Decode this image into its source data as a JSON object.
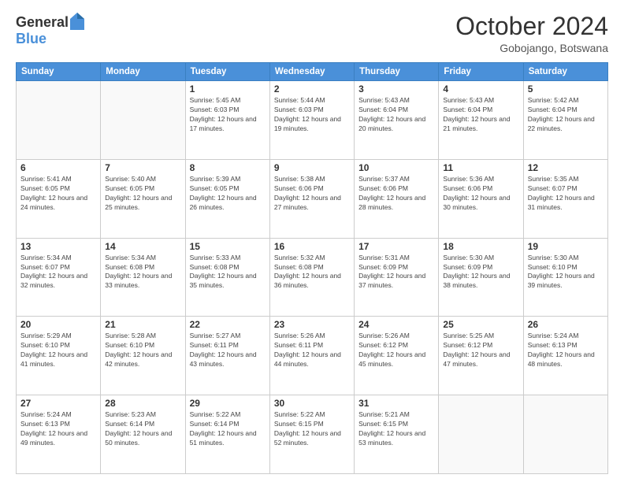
{
  "header": {
    "logo_general": "General",
    "logo_blue": "Blue",
    "month_year": "October 2024",
    "location": "Gobojango, Botswana"
  },
  "days_of_week": [
    "Sunday",
    "Monday",
    "Tuesday",
    "Wednesday",
    "Thursday",
    "Friday",
    "Saturday"
  ],
  "weeks": [
    [
      {
        "day": "",
        "empty": true
      },
      {
        "day": "",
        "empty": true
      },
      {
        "day": "1",
        "sunrise": "5:45 AM",
        "sunset": "6:03 PM",
        "daylight": "12 hours and 17 minutes."
      },
      {
        "day": "2",
        "sunrise": "5:44 AM",
        "sunset": "6:03 PM",
        "daylight": "12 hours and 19 minutes."
      },
      {
        "day": "3",
        "sunrise": "5:43 AM",
        "sunset": "6:04 PM",
        "daylight": "12 hours and 20 minutes."
      },
      {
        "day": "4",
        "sunrise": "5:43 AM",
        "sunset": "6:04 PM",
        "daylight": "12 hours and 21 minutes."
      },
      {
        "day": "5",
        "sunrise": "5:42 AM",
        "sunset": "6:04 PM",
        "daylight": "12 hours and 22 minutes."
      }
    ],
    [
      {
        "day": "6",
        "sunrise": "5:41 AM",
        "sunset": "6:05 PM",
        "daylight": "12 hours and 24 minutes."
      },
      {
        "day": "7",
        "sunrise": "5:40 AM",
        "sunset": "6:05 PM",
        "daylight": "12 hours and 25 minutes."
      },
      {
        "day": "8",
        "sunrise": "5:39 AM",
        "sunset": "6:05 PM",
        "daylight": "12 hours and 26 minutes."
      },
      {
        "day": "9",
        "sunrise": "5:38 AM",
        "sunset": "6:06 PM",
        "daylight": "12 hours and 27 minutes."
      },
      {
        "day": "10",
        "sunrise": "5:37 AM",
        "sunset": "6:06 PM",
        "daylight": "12 hours and 28 minutes."
      },
      {
        "day": "11",
        "sunrise": "5:36 AM",
        "sunset": "6:06 PM",
        "daylight": "12 hours and 30 minutes."
      },
      {
        "day": "12",
        "sunrise": "5:35 AM",
        "sunset": "6:07 PM",
        "daylight": "12 hours and 31 minutes."
      }
    ],
    [
      {
        "day": "13",
        "sunrise": "5:34 AM",
        "sunset": "6:07 PM",
        "daylight": "12 hours and 32 minutes."
      },
      {
        "day": "14",
        "sunrise": "5:34 AM",
        "sunset": "6:08 PM",
        "daylight": "12 hours and 33 minutes."
      },
      {
        "day": "15",
        "sunrise": "5:33 AM",
        "sunset": "6:08 PM",
        "daylight": "12 hours and 35 minutes."
      },
      {
        "day": "16",
        "sunrise": "5:32 AM",
        "sunset": "6:08 PM",
        "daylight": "12 hours and 36 minutes."
      },
      {
        "day": "17",
        "sunrise": "5:31 AM",
        "sunset": "6:09 PM",
        "daylight": "12 hours and 37 minutes."
      },
      {
        "day": "18",
        "sunrise": "5:30 AM",
        "sunset": "6:09 PM",
        "daylight": "12 hours and 38 minutes."
      },
      {
        "day": "19",
        "sunrise": "5:30 AM",
        "sunset": "6:10 PM",
        "daylight": "12 hours and 39 minutes."
      }
    ],
    [
      {
        "day": "20",
        "sunrise": "5:29 AM",
        "sunset": "6:10 PM",
        "daylight": "12 hours and 41 minutes."
      },
      {
        "day": "21",
        "sunrise": "5:28 AM",
        "sunset": "6:10 PM",
        "daylight": "12 hours and 42 minutes."
      },
      {
        "day": "22",
        "sunrise": "5:27 AM",
        "sunset": "6:11 PM",
        "daylight": "12 hours and 43 minutes."
      },
      {
        "day": "23",
        "sunrise": "5:26 AM",
        "sunset": "6:11 PM",
        "daylight": "12 hours and 44 minutes."
      },
      {
        "day": "24",
        "sunrise": "5:26 AM",
        "sunset": "6:12 PM",
        "daylight": "12 hours and 45 minutes."
      },
      {
        "day": "25",
        "sunrise": "5:25 AM",
        "sunset": "6:12 PM",
        "daylight": "12 hours and 47 minutes."
      },
      {
        "day": "26",
        "sunrise": "5:24 AM",
        "sunset": "6:13 PM",
        "daylight": "12 hours and 48 minutes."
      }
    ],
    [
      {
        "day": "27",
        "sunrise": "5:24 AM",
        "sunset": "6:13 PM",
        "daylight": "12 hours and 49 minutes."
      },
      {
        "day": "28",
        "sunrise": "5:23 AM",
        "sunset": "6:14 PM",
        "daylight": "12 hours and 50 minutes."
      },
      {
        "day": "29",
        "sunrise": "5:22 AM",
        "sunset": "6:14 PM",
        "daylight": "12 hours and 51 minutes."
      },
      {
        "day": "30",
        "sunrise": "5:22 AM",
        "sunset": "6:15 PM",
        "daylight": "12 hours and 52 minutes."
      },
      {
        "day": "31",
        "sunrise": "5:21 AM",
        "sunset": "6:15 PM",
        "daylight": "12 hours and 53 minutes."
      },
      {
        "day": "",
        "empty": true
      },
      {
        "day": "",
        "empty": true
      }
    ]
  ]
}
